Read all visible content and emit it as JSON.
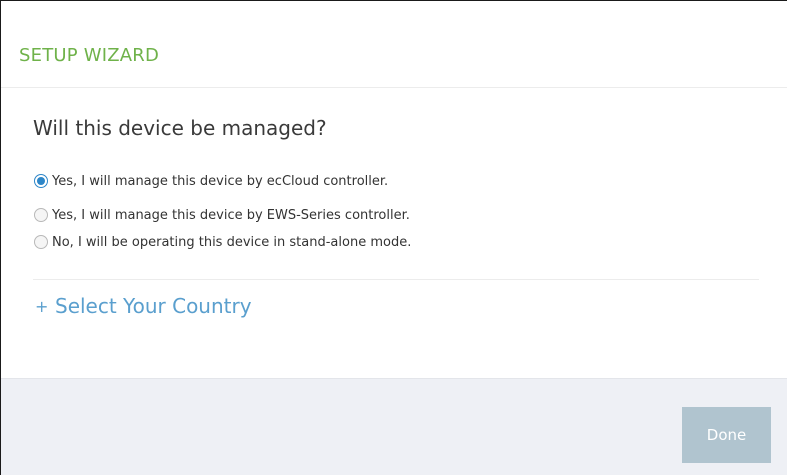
{
  "header": {
    "title": "SETUP WIZARD"
  },
  "question": {
    "text": "Will this device be managed?"
  },
  "options": [
    {
      "label": "Yes, I will manage this device by ecCloud controller.",
      "checked": true
    },
    {
      "label": "Yes, I will manage this device by EWS-Series controller.",
      "checked": false
    },
    {
      "label": "No, I will be operating this device in stand-alone mode.",
      "checked": false
    }
  ],
  "country": {
    "icon": "plus-icon",
    "label": "Select Your Country"
  },
  "footer": {
    "done_label": "Done"
  },
  "colors": {
    "title_green": "#6fb24a",
    "link_blue": "#5a9fce",
    "radio_blue": "#2d86c8",
    "done_disabled": "#b0c4cf",
    "footer_bg": "#eef0f5"
  }
}
